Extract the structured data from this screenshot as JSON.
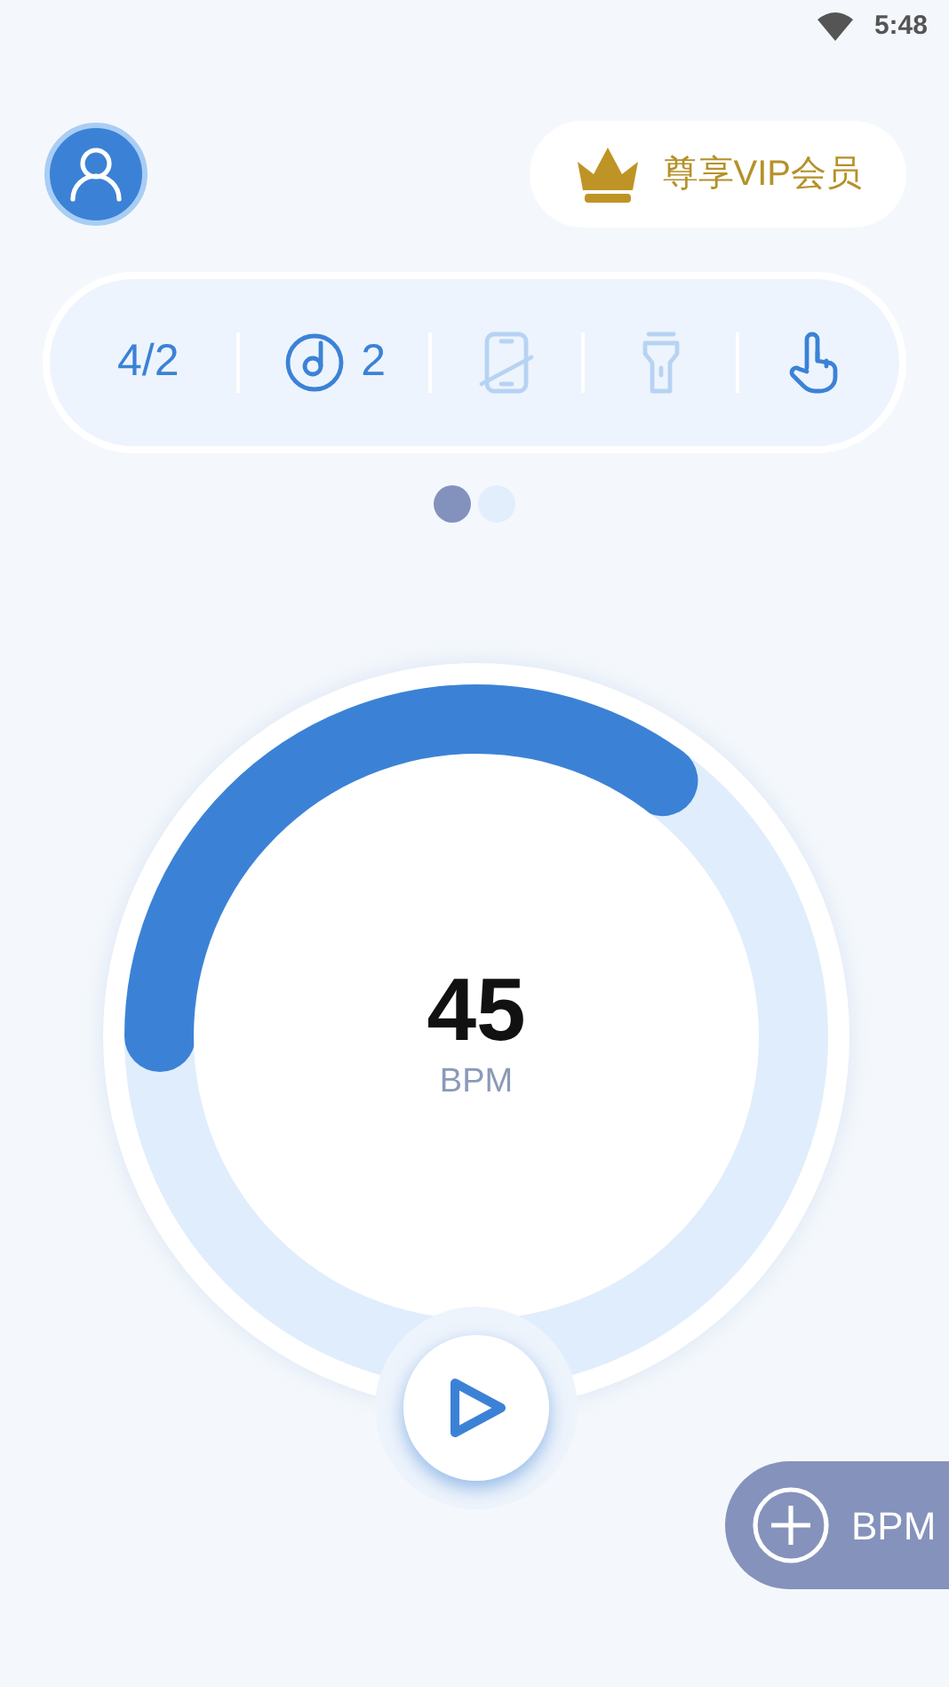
{
  "status_bar": {
    "time": "5:48"
  },
  "header": {
    "vip_label": "尊享VIP会员"
  },
  "toolbar": [
    {
      "kind": "text",
      "label": "4/2",
      "on": true
    },
    {
      "kind": "note",
      "label": "2",
      "on": true
    },
    {
      "kind": "phone",
      "on": false
    },
    {
      "kind": "flashlight",
      "on": false
    },
    {
      "kind": "tap",
      "on": true
    }
  ],
  "pager": [
    {
      "selected": true
    },
    {
      "selected": false
    }
  ],
  "dial": {
    "value": "45",
    "unit": "BPM",
    "level": 0.35
  },
  "add_button": {
    "label": "BPM"
  }
}
